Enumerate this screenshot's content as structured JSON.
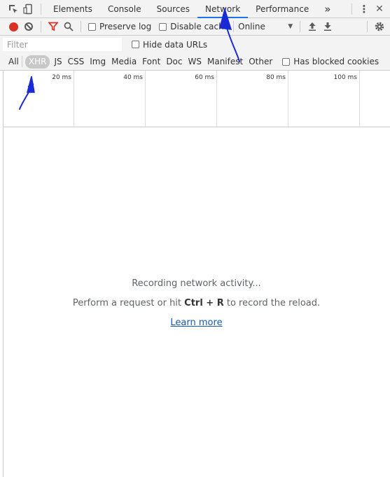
{
  "tabs": {
    "items": [
      "Elements",
      "Console",
      "Sources",
      "Network",
      "Performance"
    ],
    "more": "»",
    "menu": "⋮",
    "close": "✕"
  },
  "toolbar": {
    "preserve_log": "Preserve log",
    "disable_cache": "Disable cache",
    "throttle": "Online",
    "throttle_arrow": "▼"
  },
  "filter": {
    "placeholder": "Filter",
    "hide_data_urls": "Hide data URLs"
  },
  "types": {
    "items": [
      "All",
      "XHR",
      "JS",
      "CSS",
      "Img",
      "Media",
      "Font",
      "Doc",
      "WS",
      "Manifest",
      "Other"
    ],
    "selected": "XHR",
    "has_blocked": "Has blocked cookies"
  },
  "timeline": {
    "ticks": [
      "20 ms",
      "40 ms",
      "60 ms",
      "80 ms",
      "100 ms"
    ]
  },
  "empty": {
    "recording": "Recording network activity...",
    "perform_pre": "Perform a request or hit ",
    "shortcut": "Ctrl + R",
    "perform_post": " to record the reload.",
    "learn_more": "Learn more"
  },
  "colors": {
    "record": "#d93025",
    "active_tab_underline": "#1a73e8",
    "link": "#1558b0",
    "annotation": "#1a2bd6"
  }
}
